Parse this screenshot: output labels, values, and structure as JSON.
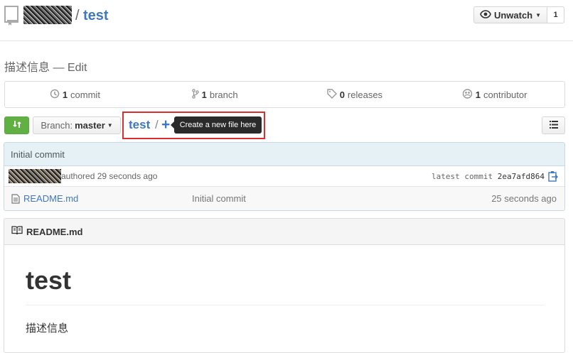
{
  "header": {
    "repo_name": "test",
    "separator": "/",
    "watch_label": "Unwatch",
    "watch_count": "1"
  },
  "description": {
    "text": "描述信息",
    "dash": "—",
    "edit_label": "Edit"
  },
  "summary": [
    {
      "count": "1",
      "label": "commit",
      "icon": "history-icon"
    },
    {
      "count": "1",
      "label": "branch",
      "icon": "branch-icon"
    },
    {
      "count": "0",
      "label": "releases",
      "icon": "tag-icon"
    },
    {
      "count": "1",
      "label": "contributor",
      "icon": "organization-icon"
    }
  ],
  "toolbar": {
    "branch_label": "Branch:",
    "branch_value": "master",
    "path_repo": "test",
    "path_sep": "/",
    "new_file_symbol": "+",
    "tooltip": "Create a new file here"
  },
  "commit": {
    "message": "Initial commit",
    "authored": "authored 29 seconds ago",
    "latest_label": "latest commit",
    "sha": "2ea7afd864"
  },
  "files": [
    {
      "name": "README.md",
      "message": "Initial commit",
      "age": "25 seconds ago"
    }
  ],
  "readme": {
    "filename": "README.md",
    "heading": "test",
    "paragraph": "描述信息"
  },
  "colors": {
    "link": "#4078c0",
    "compare_green": "#60b044",
    "highlight_red": "#d9302c",
    "commit_bg": "#e6f1f6"
  }
}
